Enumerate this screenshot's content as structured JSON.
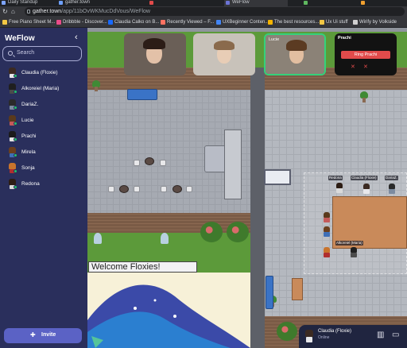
{
  "browser": {
    "tabs": [
      "Daily Standup",
      "gather.town",
      "",
      "WeFlow",
      "",
      ""
    ],
    "url_host": "gather.town",
    "url_path": "/app/11bOvWKMucDdVous/WeFlow",
    "bookmarks": [
      {
        "label": "Free Piano Sheet M...",
        "color": "#f2c744"
      },
      {
        "label": "Dribbble - Discover...",
        "color": "#ea4c89"
      },
      {
        "label": "Claudia Calko on B...",
        "color": "#1769ff"
      },
      {
        "label": "Recently Viewed – F...",
        "color": "#ff7262"
      },
      {
        "label": "UXBeginner Conten...",
        "color": "#4285f4"
      },
      {
        "label": "The best resources...",
        "color": "#f5b400"
      },
      {
        "label": "Ux Ui stuff",
        "color": "#f2c744"
      },
      {
        "label": "Wirify by Volkside",
        "color": "#d0d0d0"
      }
    ]
  },
  "sidebar": {
    "title": "WeFlow",
    "search_placeholder": "Search",
    "members": [
      {
        "name": "Claudia (Floxie)",
        "hair": "#3b2a22",
        "shirt": "#e7e7ea"
      },
      {
        "name": "Alkoreiel (Maria)",
        "hair": "#1f1f1f",
        "shirt": "#4b4b4b"
      },
      {
        "name": "DariaZ.",
        "hair": "#2a2a2a",
        "shirt": "#7c8ba0"
      },
      {
        "name": "Lucie",
        "hair": "#5a3a1c",
        "shirt": "#c45a5a"
      },
      {
        "name": "Prachi",
        "hair": "#1b1b1b",
        "shirt": "#e5e5e5"
      },
      {
        "name": "Mirela",
        "hair": "#6b3f1d",
        "shirt": "#3f6fb6"
      },
      {
        "name": "Sonja",
        "hair": "#c9742c",
        "shirt": "#b02f2f"
      },
      {
        "name": "Redona",
        "hair": "#2d1d14",
        "shirt": "#d9d9d9"
      }
    ],
    "invite_label": "Invite"
  },
  "video": {
    "tiles": [
      {
        "label": "",
        "bg": "#6a5f57",
        "face": "#e3c1a8",
        "hair": "#2c1d17"
      },
      {
        "label": "",
        "bg": "#c8c2ba",
        "face": "#e8cdb6",
        "hair": "#8a6a4c"
      },
      {
        "label": "Lucie",
        "bg": "#8b8277",
        "face": "#e2bea0",
        "hair": "#5b3b22"
      },
      {
        "label": "Prachi",
        "bg": "#121212",
        "face": "",
        "hair": ""
      }
    ],
    "ring_label": "Ring Prachi"
  },
  "map": {
    "welcome_sign": "Welcome Floxies!",
    "nametags": [
      "Redona",
      "Claudia (Floxie)",
      "DariaZ.",
      "Alkoreiel (Maria)"
    ]
  },
  "bottombar": {
    "name": "Claudia (Floxie)",
    "status": "Online"
  },
  "colors": {
    "sidebar_bg": "#2a2f5c",
    "online": "#21c16b",
    "invite": "#5b62c5",
    "ring": "#e24b4b"
  }
}
